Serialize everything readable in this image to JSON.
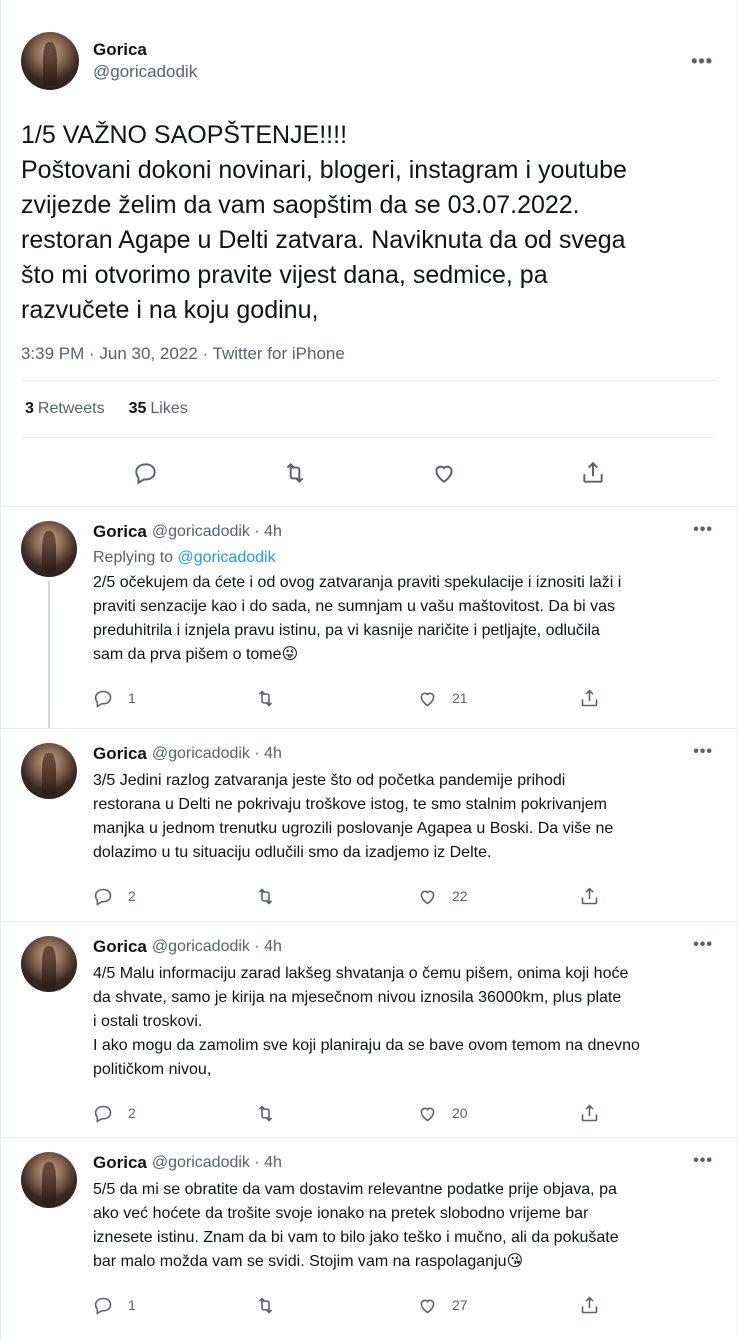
{
  "main_tweet": {
    "author_name": "Gorica",
    "author_handle": "@goricadodik",
    "text": "1/5 VAŽNO SAOPŠTENJE!!!!\nPoštovani dokoni novinari, blogeri, instagram i youtube\nzvijezde želim da vam saopštim da se 03.07.2022.\nrestoran Agape u Delti zatvara. Naviknuta da od svega\nšto mi otvorimo pravite vijest dana, sedmice, pa\nrazvučete i na koju godinu,",
    "meta": "3:39 PM · Jun 30, 2022 · Twitter for iPhone",
    "retweets_count": "3",
    "retweets_label": "Retweets",
    "likes_count": "35",
    "likes_label": "Likes"
  },
  "replies": [
    {
      "name": "Gorica",
      "handle": "@goricadodik · 4h",
      "replying_prefix": "Replying to ",
      "replying_to": "@goricadodik",
      "text": "2/5 očekujem da ćete i od ovog zatvaranja praviti spekulacije i iznositi laži i\npraviti senzacije kao i do sada, ne sumnjam u vašu maštovitost. Da bi vas\npreduhitrila i iznjela pravu istinu, pa vi kasnije naričite i petljajte, odlučila\nsam da prva pišem o tome😜",
      "replies": "1",
      "retweets": "",
      "likes": "21"
    },
    {
      "name": "Gorica",
      "handle": "@goricadodik · 4h",
      "text": "3/5 Jedini razlog zatvaranja jeste što od početka pandemije prihodi\nrestorana u Delti ne pokrivaju troškove istog, te smo stalnim pokrivanjem\nmanjka u jednom trenutku ugrozili poslovanje Agapea u Boski. Da više ne\ndolazimo u tu situaciju odlučili smo da izadjemo iz Delte.",
      "replies": "2",
      "retweets": "",
      "likes": "22"
    },
    {
      "name": "Gorica",
      "handle": "@goricadodik · 4h",
      "text": "4/5 Malu informaciju zarad lakšeg shvatanja o čemu pišem, onima koji hoće\nda shvate, samo je kirija na mjesečnom nivou iznosila 36000km, plus plate\ni ostali troskovi.\nI ako mogu da zamolim sve koji planiraju da se bave ovom temom na dnevno\npolitičkom nivou,",
      "replies": "2",
      "retweets": "",
      "likes": "20"
    },
    {
      "name": "Gorica",
      "handle": "@goricadodik · 4h",
      "text": "5/5 da mi se obratite da vam dostavim relevantne podatke prije objava, pa\nako već hoćete da trošite svoje ionako na pretek slobodno vrijeme bar\niznesete istinu. Znam da bi vam to bilo jako teško i mučno, ali da pokušate\nbar malo možda vam se svidi. Stojim vam na raspolaganju😘",
      "replies": "1",
      "retweets": "",
      "likes": "27"
    }
  ],
  "more_glyph": "•••",
  "colors": {
    "accent": "#1d9bf0",
    "secondary_text": "#536471",
    "divider": "#e6ecf0"
  },
  "icons": [
    "reply-icon",
    "retweet-icon",
    "like-icon",
    "share-icon",
    "more-icon"
  ]
}
